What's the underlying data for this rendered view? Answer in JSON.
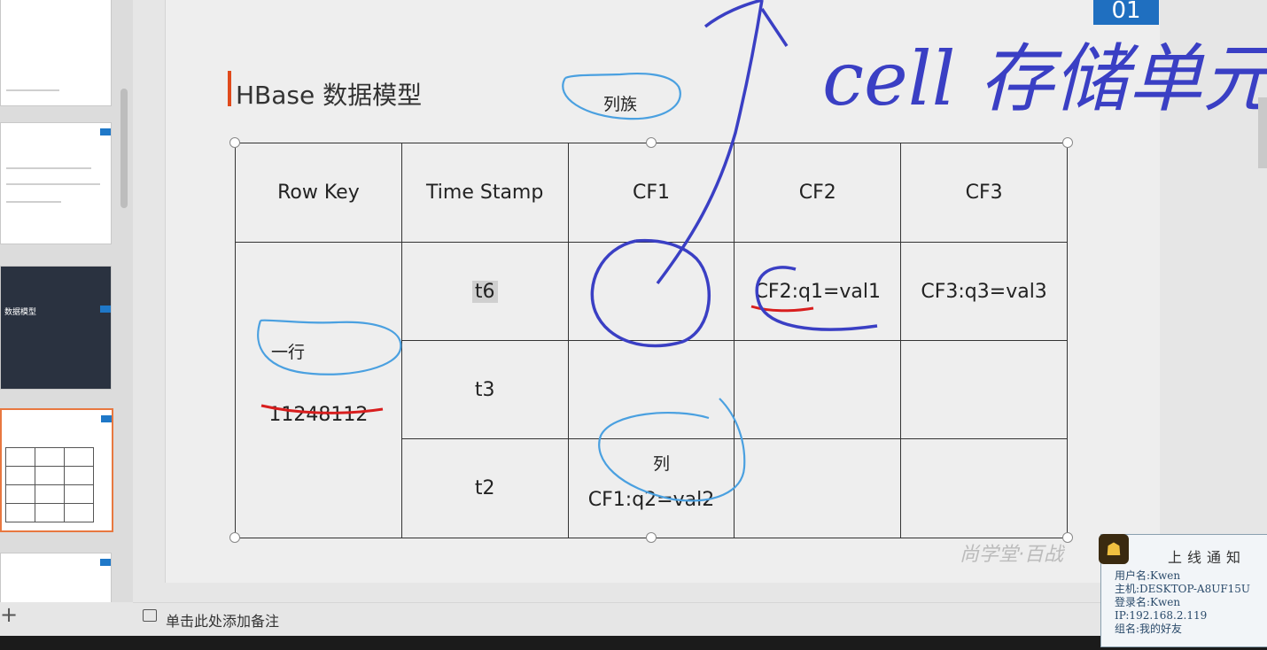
{
  "slide": {
    "page_number": "01",
    "title": "HBase 数据模型",
    "table": {
      "headers": [
        "Row Key",
        "Time Stamp",
        "CF1",
        "CF2",
        "CF3"
      ],
      "row_key": "11248112",
      "rows": [
        {
          "timestamp": "t6",
          "cf1": "",
          "cf2": "CF2:q1=val1",
          "cf3": "CF3:q3=val3"
        },
        {
          "timestamp": "t3",
          "cf1": "",
          "cf2": "",
          "cf3": ""
        },
        {
          "timestamp": "t2",
          "cf1": "CF1:q2=val2",
          "cf2": "",
          "cf3": ""
        }
      ]
    }
  },
  "annotations": {
    "column_family": "列族",
    "one_row": "一行",
    "column": "列",
    "cell_storage": "cell 存储单元"
  },
  "notes_placeholder": "单击此处添加备注",
  "thumbnails": {
    "section_title": "数据模型"
  },
  "watermark": "尚学堂·百战",
  "notification": {
    "title": "上线通知",
    "lines": [
      "用户名:Kwen",
      "主机:DESKTOP-A8UF15U",
      "登录名:Kwen",
      "IP:192.168.2.119",
      "组名:我的好友"
    ]
  },
  "colors": {
    "accent": "#e04a1c",
    "page_badge": "#1f6fc0",
    "ink_blue": "#3a3fc4",
    "ink_light_blue": "#4aa0e0",
    "ink_red": "#d81e1e"
  }
}
